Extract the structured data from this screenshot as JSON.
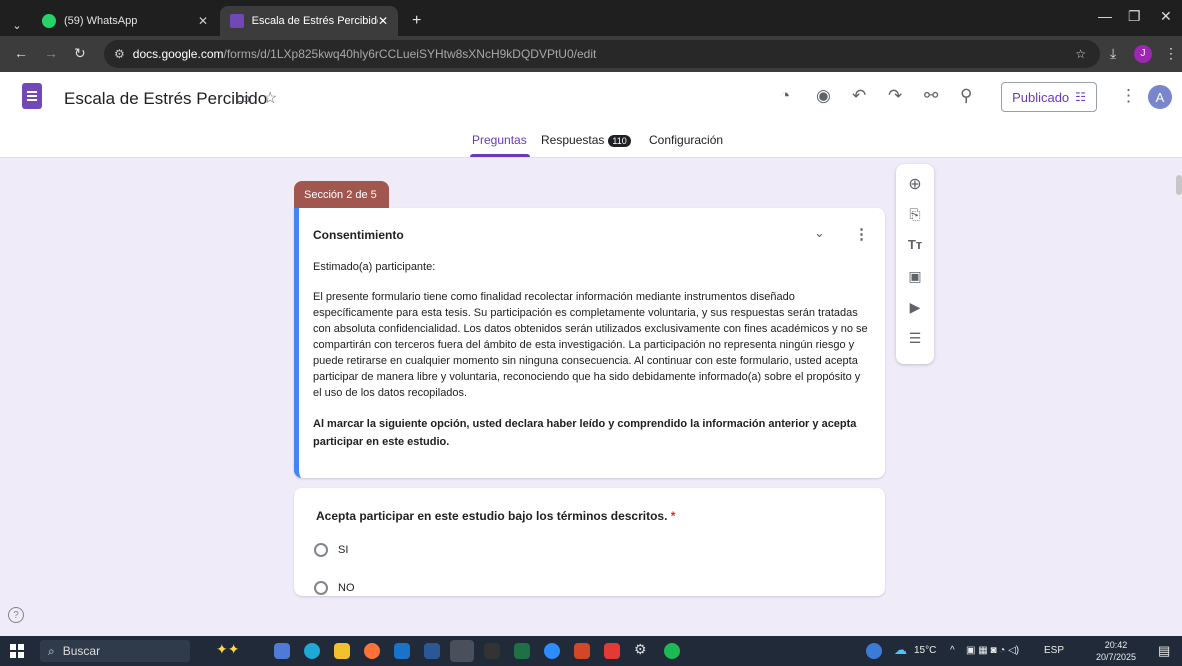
{
  "browser": {
    "tabs": [
      {
        "label": "(59) WhatsApp",
        "icon": "whatsapp-icon",
        "color": "#25d366"
      },
      {
        "label": "Escala de Estrés Percibido - For",
        "icon": "forms-icon",
        "color": "#7248b9"
      }
    ],
    "url_domain": "docs.google.com",
    "url_path": "/forms/d/1LXp825kwq40hly6rCCLueiSYHtw8sXNcH9kDQDVPtU0/edit",
    "profile_initial": "J"
  },
  "form": {
    "title": "Escala de Estrés Percibido",
    "publish_label": "Publicado",
    "avatar_initial": "A",
    "tabs": {
      "questions": "Preguntas",
      "responses": "Respuestas",
      "responses_count": "110",
      "settings": "Configuración"
    },
    "section_label": "Sección 2 de 5",
    "section_card": {
      "title": "Consentimiento",
      "greeting": "Estimado(a) participante:",
      "body": "El presente formulario tiene como finalidad recolectar información mediante instrumentos diseñado específicamente para esta tesis. Su participación es completamente voluntaria, y sus respuestas serán tratadas con absoluta confidencialidad. Los datos obtenidos serán utilizados exclusivamente con fines académicos y no se compartirán con terceros fuera del ámbito de esta investigación. La participación no representa ningún riesgo y puede retirarse en cualquier momento sin ninguna consecuencia. Al continuar con este formulario, usted acepta participar de manera libre y voluntaria, reconociendo que ha sido debidamente informado(a) sobre el propósito y el uso de los datos recopilados.",
      "statement": "Al marcar la siguiente opción, usted declara haber leído y comprendido la información anterior y acepta participar en este estudio."
    },
    "question": {
      "text": "Acepta participar en este estudio bajo los términos descritos.",
      "required_mark": "*",
      "options": [
        "SI",
        "NO"
      ]
    }
  },
  "taskbar": {
    "search_label": "Buscar",
    "temperature": "15°C",
    "language": "ESP",
    "time": "20:42",
    "date": "20/7/2025"
  },
  "colors": {
    "accent": "#673ab7",
    "section": "#a1574f",
    "active_border": "#4285f4",
    "background": "#f0ebf8"
  }
}
